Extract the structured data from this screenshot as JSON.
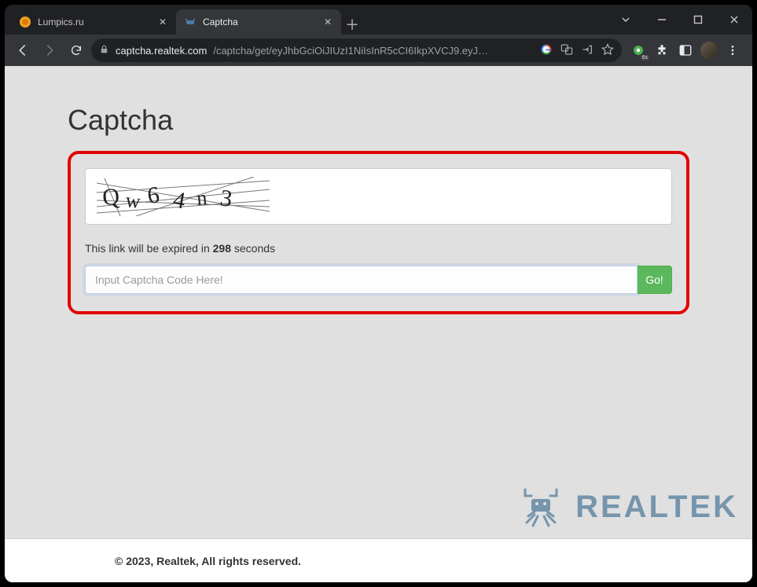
{
  "window": {
    "tabs": [
      {
        "label": "Lumpics.ru",
        "active": false,
        "favicon": "orange-circle-icon"
      },
      {
        "label": "Captcha",
        "active": true,
        "favicon": "crab-icon"
      }
    ]
  },
  "toolbar": {
    "url_host": "captcha.realtek.com",
    "url_path": "/captcha/get/eyJhbGciOiJIUzI1NiIsInR5cCI6IkpXVCJ9.eyJ…"
  },
  "page": {
    "title": "Captcha",
    "captcha_text": "Qw64n3",
    "expire_prefix": "This link will be expired in ",
    "expire_seconds": "298",
    "expire_suffix": " seconds",
    "input_placeholder": "Input Captcha Code Here!",
    "go_label": "Go!"
  },
  "watermark": {
    "brand": "REALTEK"
  },
  "footer": {
    "text": "© 2023, Realtek, All rights reserved."
  }
}
